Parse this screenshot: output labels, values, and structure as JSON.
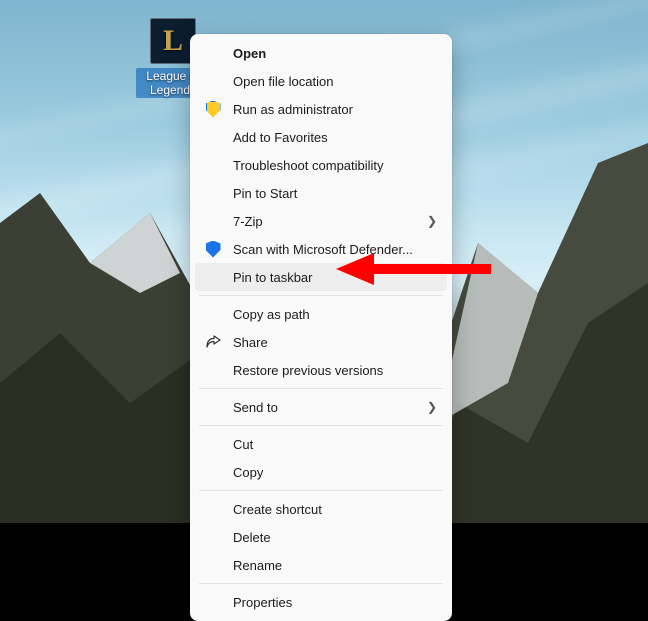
{
  "desktop": {
    "icon_label": "League of Legends",
    "icon_letter": "L"
  },
  "menu": {
    "open": "Open",
    "open_location": "Open file location",
    "run_admin": "Run as administrator",
    "add_fav": "Add to Favorites",
    "troubleshoot": "Troubleshoot compatibility",
    "pin_start": "Pin to Start",
    "sevenzip": "7-Zip",
    "defender": "Scan with Microsoft Defender...",
    "pin_taskbar": "Pin to taskbar",
    "copy_path": "Copy as path",
    "share": "Share",
    "restore": "Restore previous versions",
    "send_to": "Send to",
    "cut": "Cut",
    "copy": "Copy",
    "create_shortcut": "Create shortcut",
    "delete": "Delete",
    "rename": "Rename",
    "properties": "Properties"
  }
}
